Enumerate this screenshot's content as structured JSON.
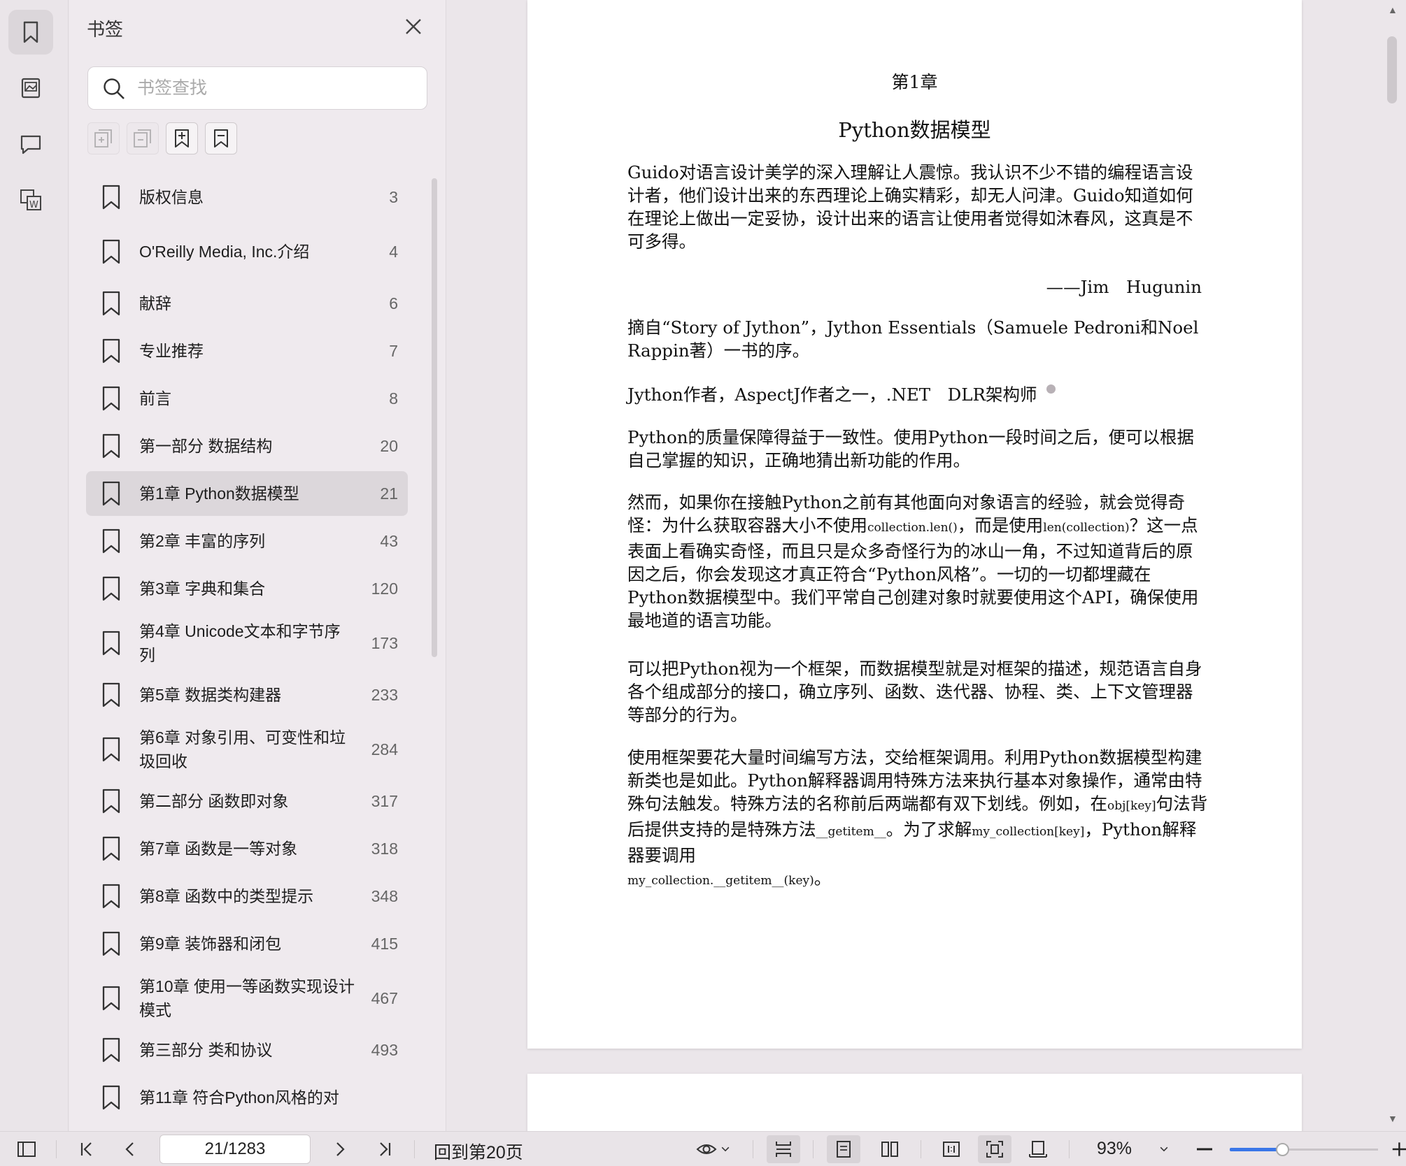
{
  "panel": {
    "title": "书签",
    "search_placeholder": "书签查找"
  },
  "bookmarks": [
    {
      "label": "版权信息",
      "page": "3"
    },
    {
      "label": "O'Reilly Media, Inc.介绍",
      "page": "4"
    },
    {
      "label": "献辞",
      "page": "6"
    },
    {
      "label": "专业推荐",
      "page": "7"
    },
    {
      "label": "前言",
      "page": "8"
    },
    {
      "label": "第一部分 数据结构",
      "page": "20"
    },
    {
      "label": "第1章 Python数据模型",
      "page": "21",
      "active": true
    },
    {
      "label": "第2章 丰富的序列",
      "page": "43"
    },
    {
      "label": "第3章 字典和集合",
      "page": "120"
    },
    {
      "label": "第4章 Unicode文本和字节序列",
      "page": "173"
    },
    {
      "label": "第5章 数据类构建器",
      "page": "233"
    },
    {
      "label": "第6章 对象引用、可变性和垃圾回收",
      "page": "284"
    },
    {
      "label": "第二部分 函数即对象",
      "page": "317"
    },
    {
      "label": "第7章 函数是一等对象",
      "page": "318"
    },
    {
      "label": "第8章 函数中的类型提示",
      "page": "348"
    },
    {
      "label": "第9章 装饰器和闭包",
      "page": "415"
    },
    {
      "label": "第10章 使用一等函数实现设计模式",
      "page": "467"
    },
    {
      "label": "第三部分 类和协议",
      "page": "493"
    },
    {
      "label": "第11章 符合Python风格的对",
      "page": ""
    }
  ],
  "document": {
    "chapter_num": "第1章",
    "chapter_title": "Python数据模型",
    "p1": "Guido对语言设计美学的深入理解让人震惊。我认识不少不错的编程语言设计者，他们设计出来的东西理论上确实精彩，却无人问津。Guido知道如何在理论上做出一定妥协，设计出来的语言让使用者觉得如沐春风，这真是不可多得。",
    "attribution": "——Jim　Hugunin",
    "p2": "摘自“Story of Jython”，Jython Essentials（Samuele Pedroni和Noel Rappin著）一书的序。",
    "p3": "Jython作者，AspectJ作者之一，.NET　DLR架构师",
    "p4": "Python的质量保障得益于一致性。使用Python一段时间之后，便可以根据自己掌握的知识，正确地猜出新功能的作用。",
    "p5_a": "然而，如果你在接触Python之前有其他面向对象语言的经验，就会觉得奇怪：为什么获取容器大小不使用",
    "p5_code1": "collection.len()",
    "p5_b": "，而是使用",
    "p5_code2": "len(collection)",
    "p5_c": "？这一点表面上看确实奇怪，而且只是众多奇怪行为的冰山一角，不过知道背后的原因之后，你会发现这才真正符合“Python风格”。一切的一切都埋藏在Python数据模型中。我们平常自己创建对象时就要使用这个API，确保使用最地道的语言功能。",
    "p6": "可以把Python视为一个框架，而数据模型就是对框架的描述，规范语言自身各个组成部分的接口，确立序列、函数、迭代器、协程、类、上下文管理器等部分的行为。",
    "p7_a": "使用框架要花大量时间编写方法，交给框架调用。利用Python数据模型构建新类也是如此。Python解释器调用特殊方法来执行基本对象操作，通常由特殊句法触发。特殊方法的名称前后两端都有双下划线。例如，在",
    "p7_code1": "obj[key]",
    "p7_b": "句法背后提供支持的是特殊方法",
    "p7_code2": "__getitem__",
    "p7_c": "。为了求解",
    "p7_code3": "my_collection[key]",
    "p7_d": "，Python解释器要调用",
    "p7_code4": "my_collection.__getitem__(key)",
    "p7_e": "。"
  },
  "toolbar": {
    "page_value": "21/1283",
    "back_label": "回到第20页",
    "zoom": "93%",
    "zoom_fraction": 0.36
  },
  "colors": {
    "accent": "#3a76e8",
    "active_row": "#dcd7db"
  }
}
